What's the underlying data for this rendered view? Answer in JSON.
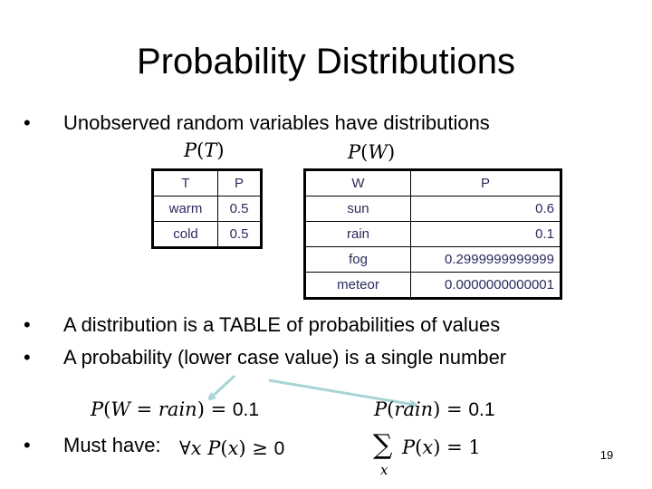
{
  "slide": {
    "title": "Probability Distributions",
    "page_number": "19",
    "bullets": [
      {
        "bullet_icon": "•",
        "text": "Unobserved random variables have distributions"
      },
      {
        "bullet_icon": "•",
        "text": "A distribution is a TABLE of probabilities of values"
      },
      {
        "bullet_icon": "•",
        "text": "A probability (lower case value) is a single number"
      },
      {
        "bullet_icon": "•",
        "text": "Must have:"
      }
    ],
    "arrow_color": "#a8d4d8"
  },
  "tables": {
    "temperature": {
      "caption": {
        "p": "P",
        "open": "(",
        "var": "T",
        "close": ")"
      },
      "headers": [
        "T",
        "P"
      ],
      "rows": [
        {
          "value": "warm",
          "prob": "0.5"
        },
        {
          "value": "cold",
          "prob": "0.5"
        }
      ]
    },
    "weather": {
      "caption": {
        "p": "P",
        "open": "(",
        "var": "W",
        "close": ")"
      },
      "headers": [
        "W",
        "P"
      ],
      "rows": [
        {
          "value": "sun",
          "prob": "0.6"
        },
        {
          "value": "rain",
          "prob": "0.1"
        },
        {
          "value": "fog",
          "prob": "0.2999999999999"
        },
        {
          "value": "meteor",
          "prob": "0.0000000000001"
        }
      ]
    }
  },
  "equations": {
    "joint_example": {
      "p": "P",
      "lhs_var": "W",
      "eq": " = ",
      "val": "rain",
      "rhs": " = ",
      "num": "0.1"
    },
    "short_example": {
      "p": "P",
      "val": "rain",
      "rhs": " = ",
      "num": "0.1"
    },
    "nonneg": {
      "forall": "∀",
      "x": "x",
      "p": "P",
      "rel": " ≥ ",
      "num": "0"
    },
    "normalize": {
      "sigma": "∑",
      "sub": "x",
      "p": "P",
      "x": "x",
      "rel": " = ",
      "num": "1"
    }
  }
}
